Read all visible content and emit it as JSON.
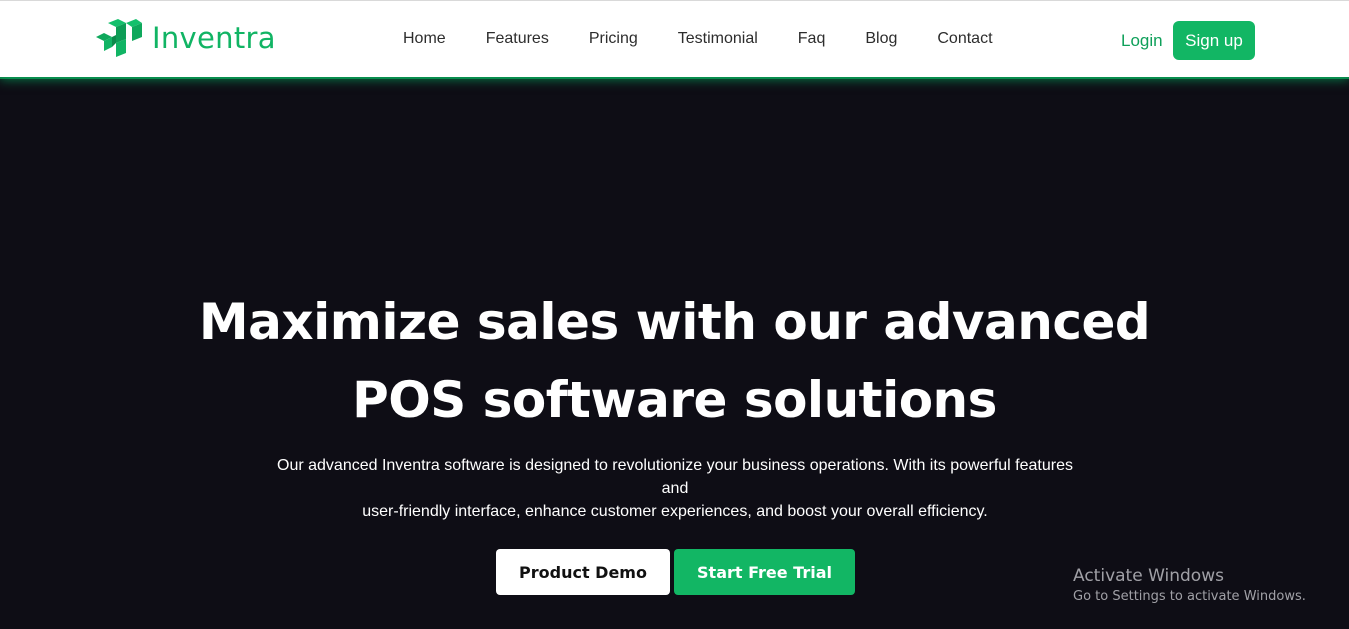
{
  "brand": {
    "name": "Inventra",
    "color": "#11b464"
  },
  "nav": {
    "items": [
      "Home",
      "Features",
      "Pricing",
      "Testimonial",
      "Faq",
      "Blog",
      "Contact"
    ]
  },
  "auth": {
    "login_label": "Login",
    "signup_label": "Sign up"
  },
  "hero": {
    "title_line1": "Maximize sales with our advanced",
    "title_line2": "POS software solutions",
    "subtitle_line1": "Our advanced Inventra software is designed to revolutionize your business operations. With its powerful features and",
    "subtitle_line2": "user-friendly interface, enhance customer experiences, and boost your overall efficiency.",
    "demo_label": "Product Demo",
    "trial_label": "Start Free Trial"
  },
  "watermark": {
    "title": "Activate Windows",
    "subtitle": "Go to Settings to activate Windows."
  },
  "colors": {
    "accent": "#12b664",
    "background": "#0e0d15",
    "header": "#ffffff"
  }
}
